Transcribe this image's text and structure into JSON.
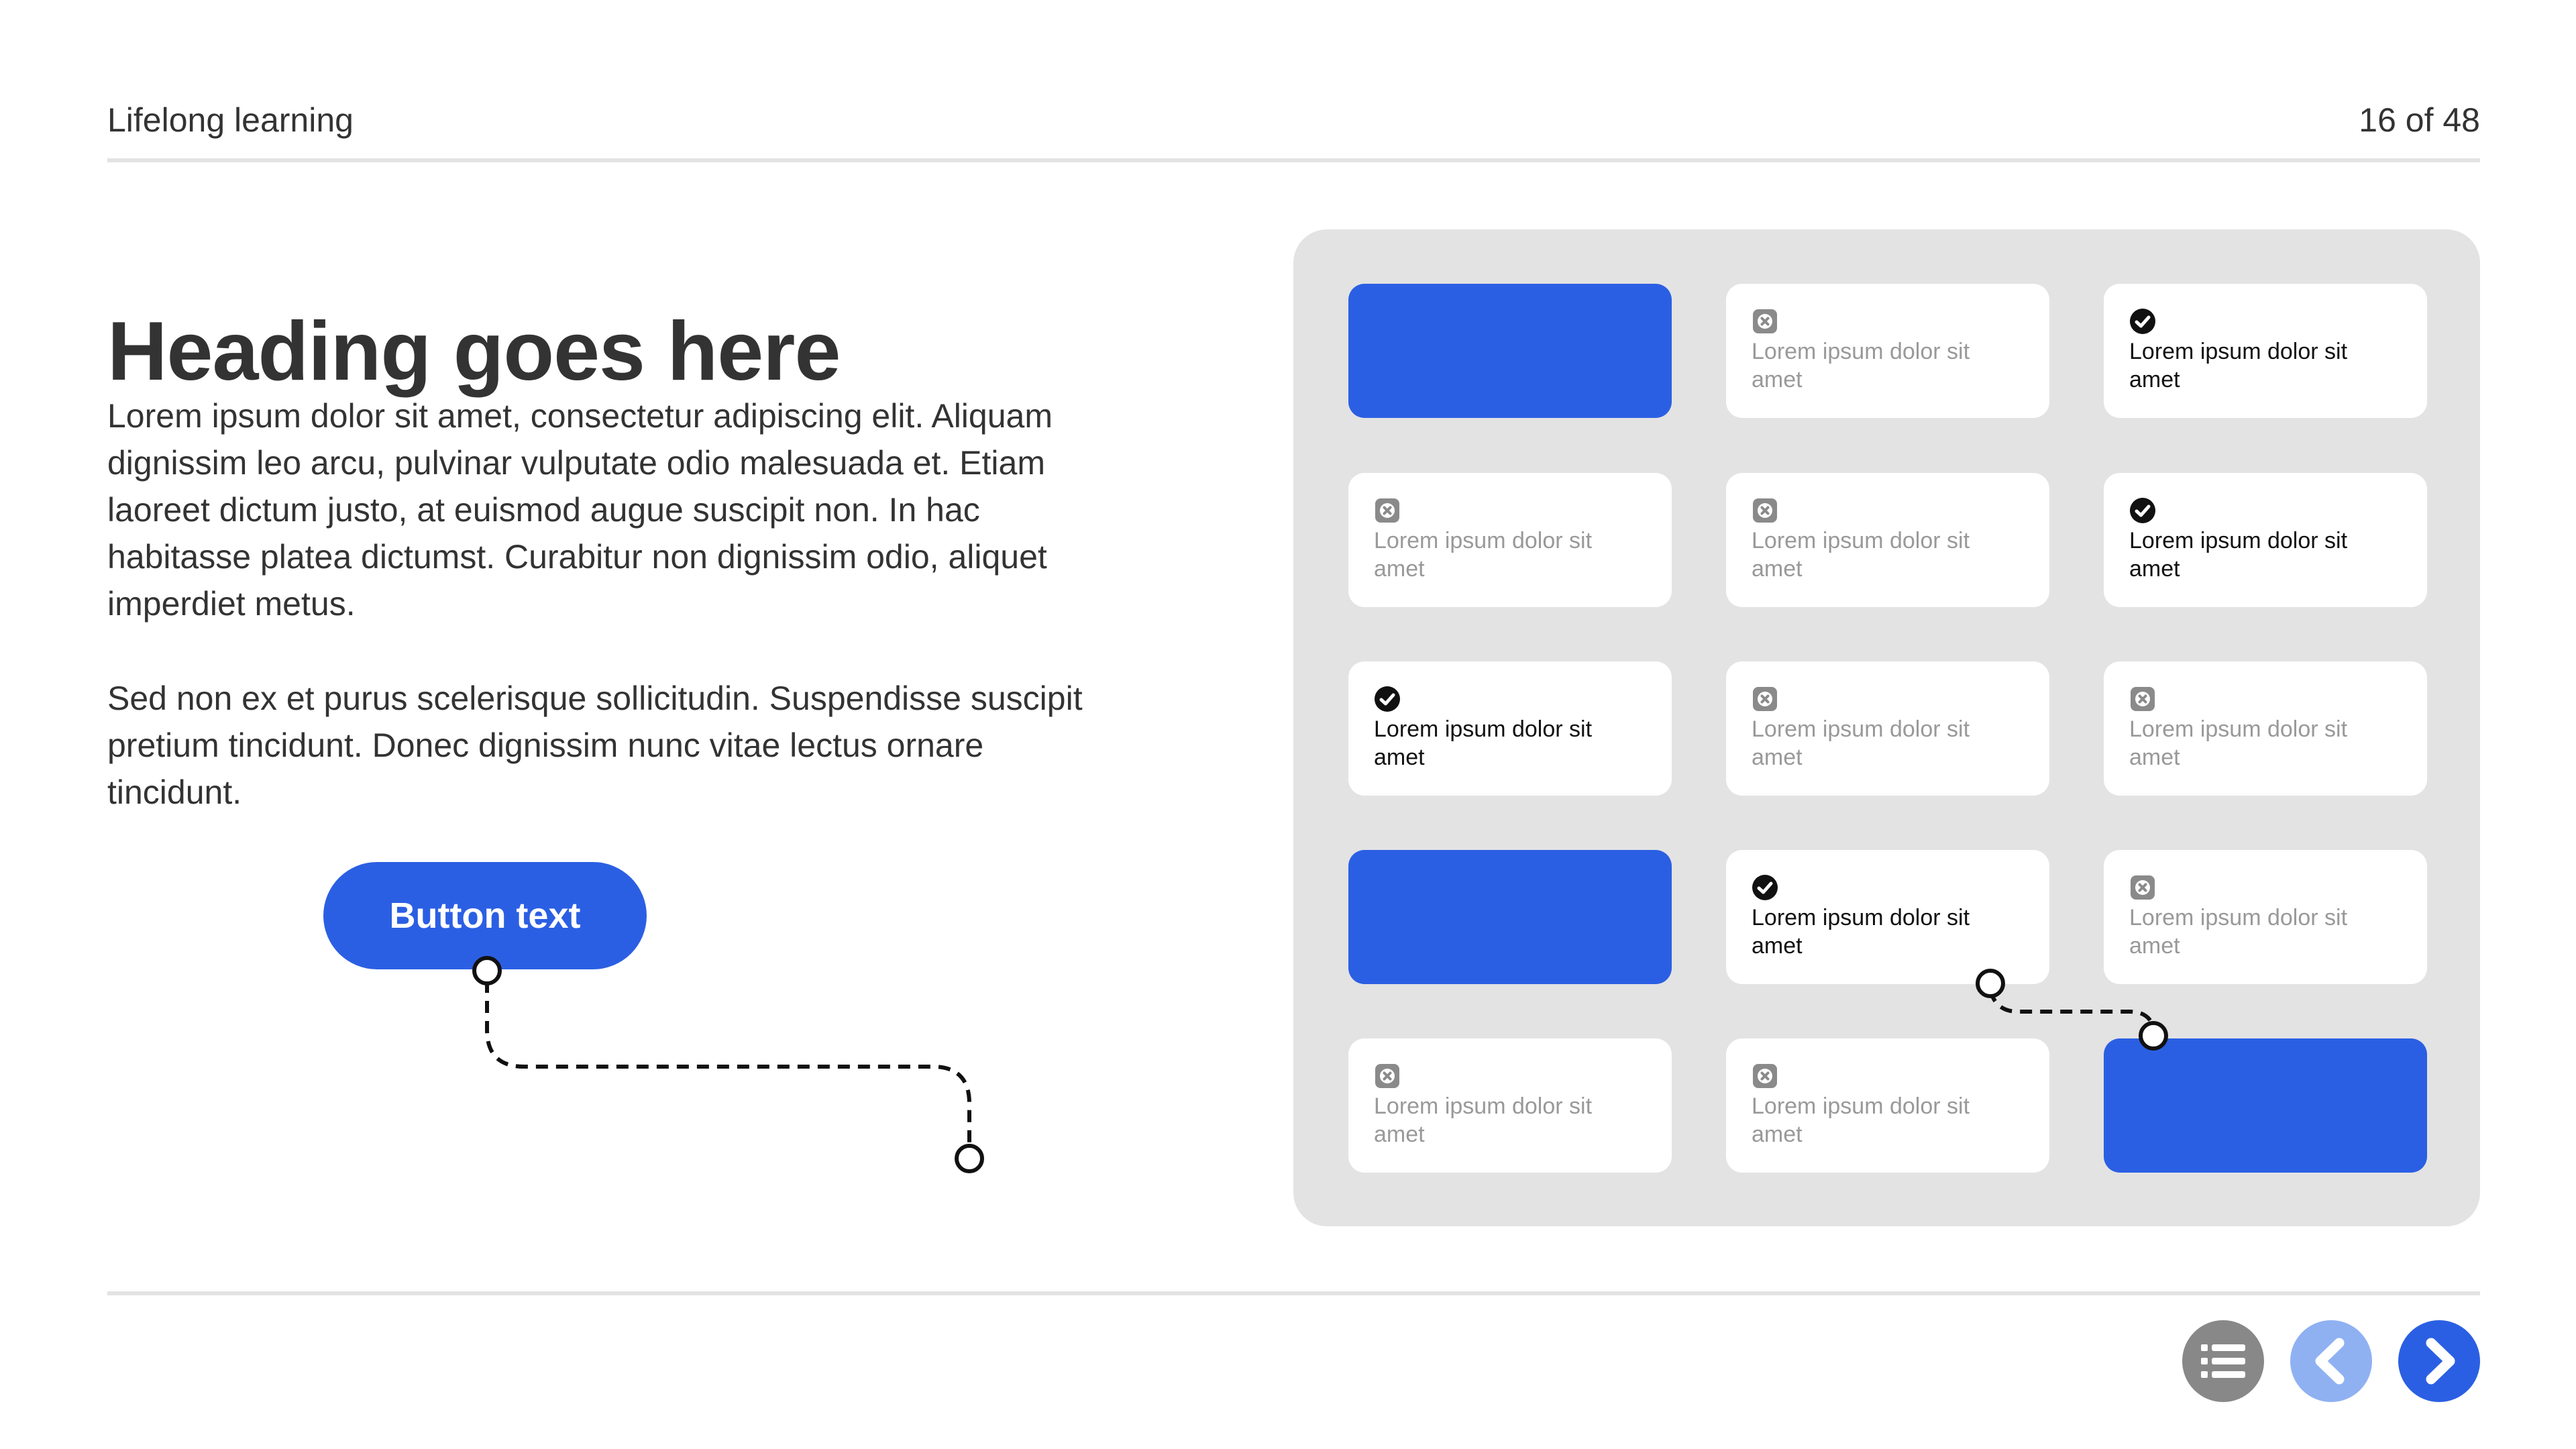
{
  "header": {
    "title": "Lifelong learning",
    "page_counter": "16 of 48"
  },
  "content": {
    "heading": "Heading goes here",
    "paragraph_1": "Lorem ipsum dolor sit amet, consectetur adipiscing elit. Aliquam dignissim leo arcu, pulvinar vulputate odio malesuada et. Etiam laoreet dictum justo, at euismod augue suscipit non. In hac habitasse platea dictumst. Curabitur non dignissim odio, aliquet imperdiet metus.",
    "paragraph_2": "Sed non ex et purus scelerisque sollicitudin. Suspendisse suscipit pretium tincidunt. Donec dignissim nunc vitae lectus ornare tincidunt.",
    "button_label": "Button text"
  },
  "grid": {
    "tiles": [
      {
        "state": "blank",
        "label": ""
      },
      {
        "state": "unchecked",
        "label": "Lorem ipsum dolor sit amet"
      },
      {
        "state": "checked",
        "label": "Lorem ipsum dolor sit amet"
      },
      {
        "state": "unchecked",
        "label": "Lorem ipsum dolor sit amet"
      },
      {
        "state": "unchecked",
        "label": "Lorem ipsum dolor sit amet"
      },
      {
        "state": "checked",
        "label": "Lorem ipsum dolor sit amet"
      },
      {
        "state": "checked",
        "label": "Lorem ipsum dolor sit amet"
      },
      {
        "state": "unchecked",
        "label": "Lorem ipsum dolor sit amet"
      },
      {
        "state": "unchecked",
        "label": "Lorem ipsum dolor sit amet"
      },
      {
        "state": "blank",
        "label": ""
      },
      {
        "state": "checked",
        "label": "Lorem ipsum dolor sit amet"
      },
      {
        "state": "unchecked",
        "label": "Lorem ipsum dolor sit amet"
      },
      {
        "state": "unchecked",
        "label": "Lorem ipsum dolor sit amet"
      },
      {
        "state": "unchecked",
        "label": "Lorem ipsum dolor sit amet"
      },
      {
        "state": "blank",
        "label": ""
      }
    ]
  },
  "navigation": {
    "menu_icon": "list-icon",
    "prev_icon": "chevron-left-icon",
    "next_icon": "chevron-right-icon"
  },
  "colors": {
    "accent": "#2b5fe3",
    "accent_light": "#8fb1f2",
    "panel_bg": "#e3e3e3",
    "menu_button": "#888888",
    "text": "#333333",
    "muted_text": "#999999"
  }
}
